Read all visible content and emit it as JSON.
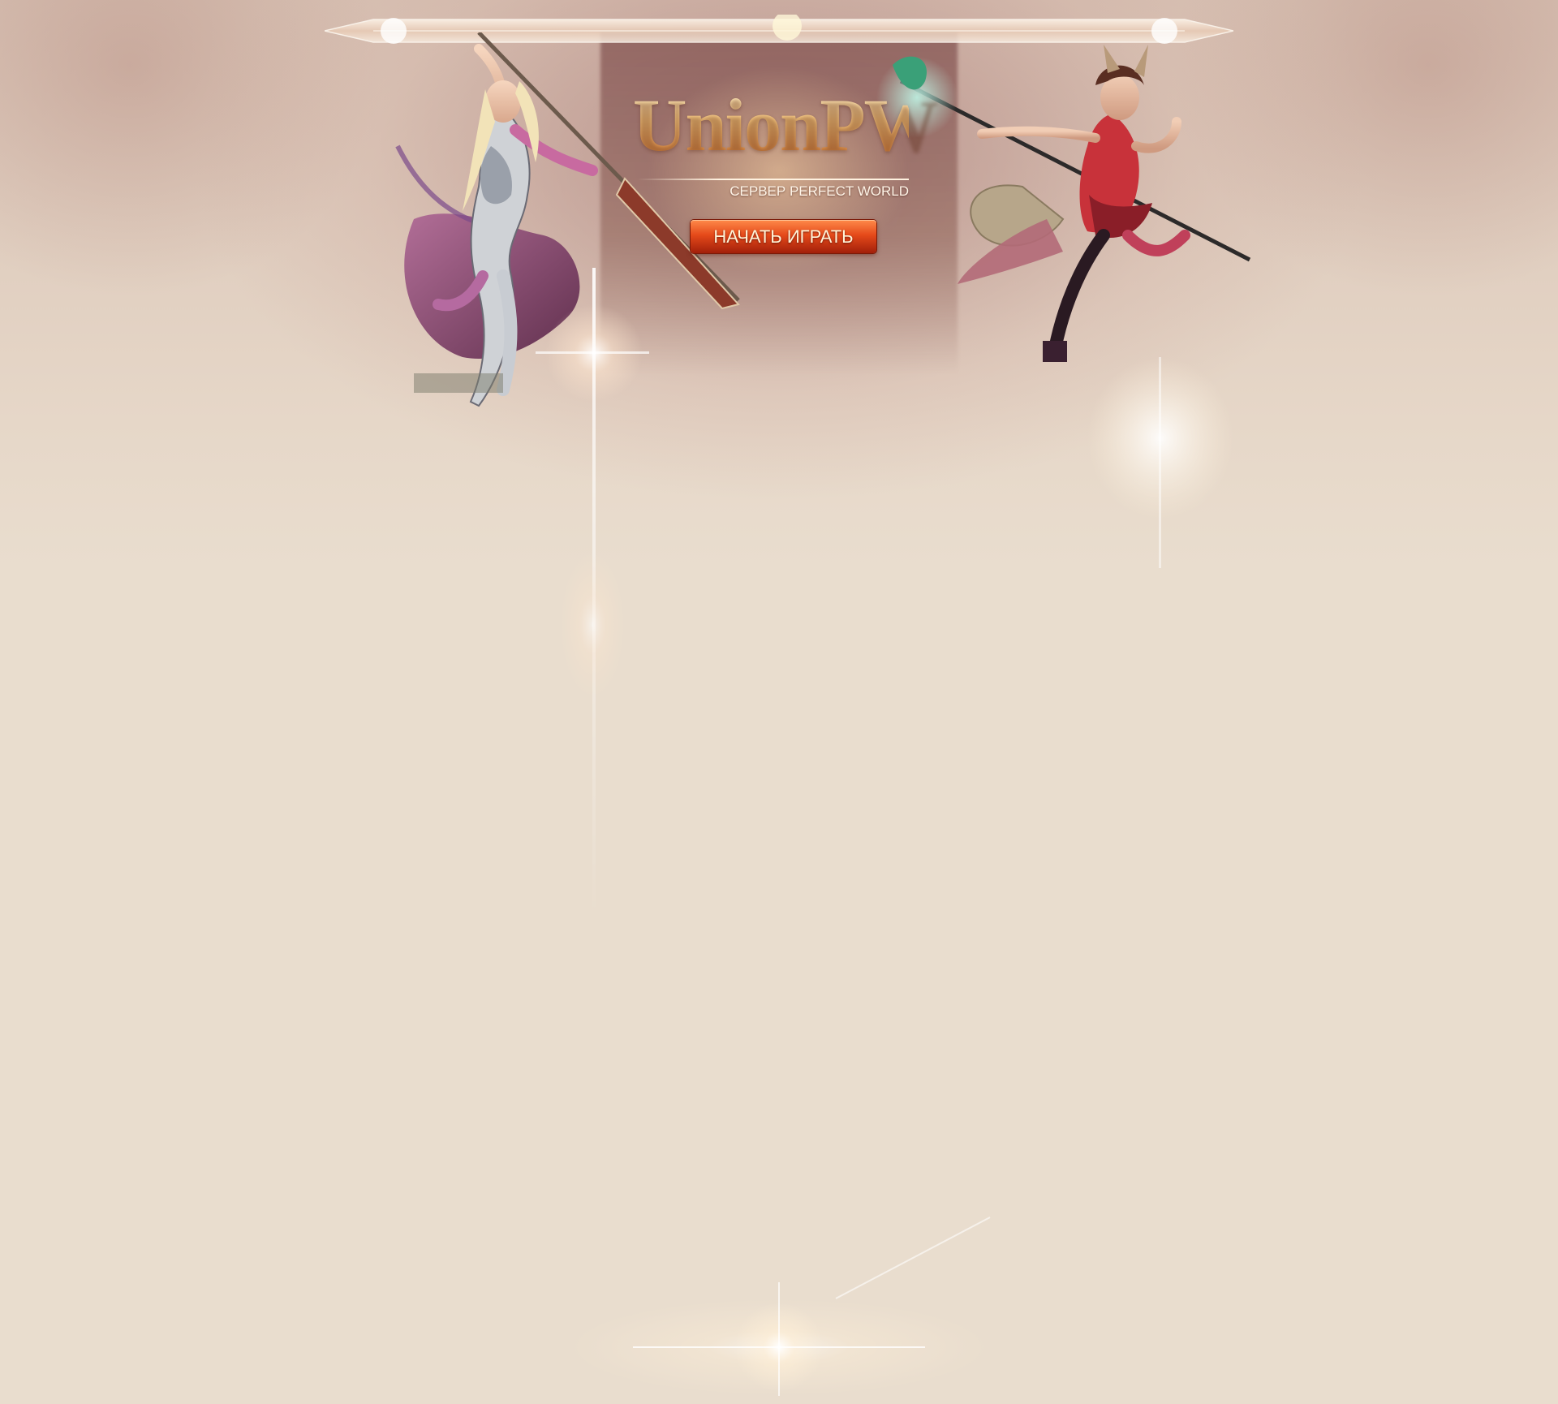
{
  "header": {
    "logo_title": "UnionPW",
    "logo_subtitle": "СЕРВЕР PERFECT WORLD",
    "play_button_label": "НАЧАТЬ ИГРАТЬ"
  },
  "characters": [
    {
      "name": "hero-left-illustration"
    },
    {
      "name": "hero-right-illustration"
    }
  ],
  "colors": {
    "background": "#e9ddce",
    "button": "#e54a1a",
    "logo": "#f3c27a"
  }
}
